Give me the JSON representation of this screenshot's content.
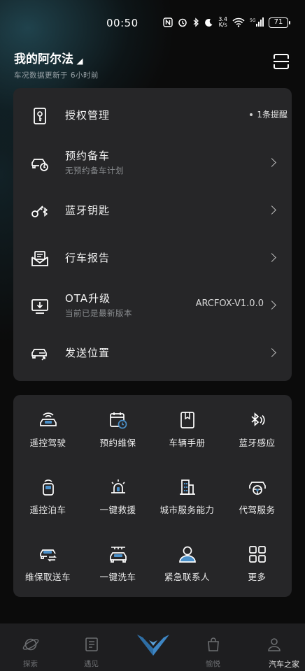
{
  "status_bar": {
    "time": "00:50",
    "net_speed_top": "3.4",
    "net_speed_bottom": "K/s",
    "battery": "71",
    "icons": [
      "nfc-icon",
      "alarm-icon",
      "bluetooth-icon",
      "moon-icon",
      "wifi-icon",
      "signal-5g-icon",
      "battery-icon"
    ]
  },
  "header": {
    "car_name": "我的阿尔法",
    "update_text": "车况数据更新于 6小时前",
    "scan_icon": "scan-icon"
  },
  "menu": {
    "items": [
      {
        "title": "授权管理",
        "subtitle": "",
        "right_text": "",
        "notice": "1条提醒",
        "icon": "authorization-icon"
      },
      {
        "title": "预约备车",
        "subtitle": "无预约备车计划",
        "right_text": "",
        "notice": "",
        "icon": "car-schedule-icon"
      },
      {
        "title": "蓝牙钥匙",
        "subtitle": "",
        "right_text": "",
        "notice": "",
        "icon": "bluetooth-key-icon"
      },
      {
        "title": "行车报告",
        "subtitle": "",
        "right_text": "",
        "notice": "",
        "icon": "report-mail-icon"
      },
      {
        "title": "OTA升级",
        "subtitle": "当前已是最新版本",
        "right_text": "ARCFOX-V1.0.0",
        "notice": "",
        "icon": "ota-download-icon"
      },
      {
        "title": "发送位置",
        "subtitle": "",
        "right_text": "",
        "notice": "",
        "icon": "send-location-icon"
      }
    ]
  },
  "services": {
    "items": [
      {
        "label": "遥控驾驶",
        "icon": "remote-drive-icon"
      },
      {
        "label": "预约维保",
        "icon": "maintenance-calendar-icon"
      },
      {
        "label": "车辆手册",
        "icon": "manual-book-icon"
      },
      {
        "label": "蓝牙感应",
        "icon": "bluetooth-sense-icon"
      },
      {
        "label": "遥控泊车",
        "icon": "remote-parking-icon"
      },
      {
        "label": "一键救援",
        "icon": "rescue-siren-icon"
      },
      {
        "label": "城市服务能力",
        "icon": "city-building-icon"
      },
      {
        "label": "代驾服务",
        "icon": "chauffeur-icon"
      },
      {
        "label": "维保取送车",
        "icon": "pickup-delivery-icon"
      },
      {
        "label": "一键洗车",
        "icon": "car-wash-icon"
      },
      {
        "label": "紧急联系人",
        "icon": "emergency-contact-icon"
      },
      {
        "label": "更多",
        "icon": "more-grid-icon"
      }
    ]
  },
  "bottom_nav": {
    "items": [
      {
        "label": "探索",
        "icon": "planet-icon"
      },
      {
        "label": "遇见",
        "icon": "news-icon"
      },
      {
        "label": "",
        "icon": "arcfox-logo-icon"
      },
      {
        "label": "愉悦",
        "icon": "shopping-bag-icon"
      },
      {
        "label": "",
        "icon": "profile-icon"
      }
    ]
  },
  "watermark": "汽车之家",
  "colors": {
    "card": "#262628",
    "accent_blue": "#4a90c9",
    "background": "#0b0b0b"
  }
}
